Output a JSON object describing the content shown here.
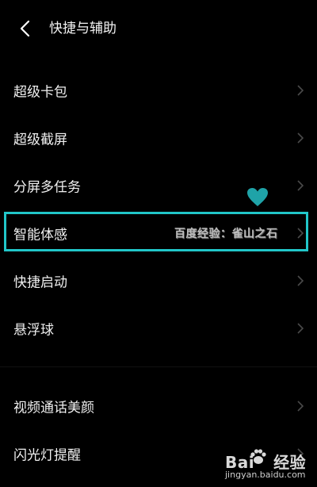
{
  "header": {
    "title": "快捷与辅助"
  },
  "items": [
    {
      "label": "超级卡包"
    },
    {
      "label": "超级截屏"
    },
    {
      "label": "分屏多任务"
    },
    {
      "label": "智能体感"
    },
    {
      "label": "快捷启动"
    },
    {
      "label": "悬浮球"
    },
    {
      "label": "视频通话美颜"
    },
    {
      "label": "闪光灯提醒"
    }
  ],
  "overlay": {
    "watermark_text": "百度经验：雀山之石",
    "highlight_color": "#21c6c9",
    "heart_color": "#1fa3a8"
  },
  "logo": {
    "brand_left": "Bai",
    "brand_right": "经验",
    "site": "jingyan.baidu.com"
  }
}
